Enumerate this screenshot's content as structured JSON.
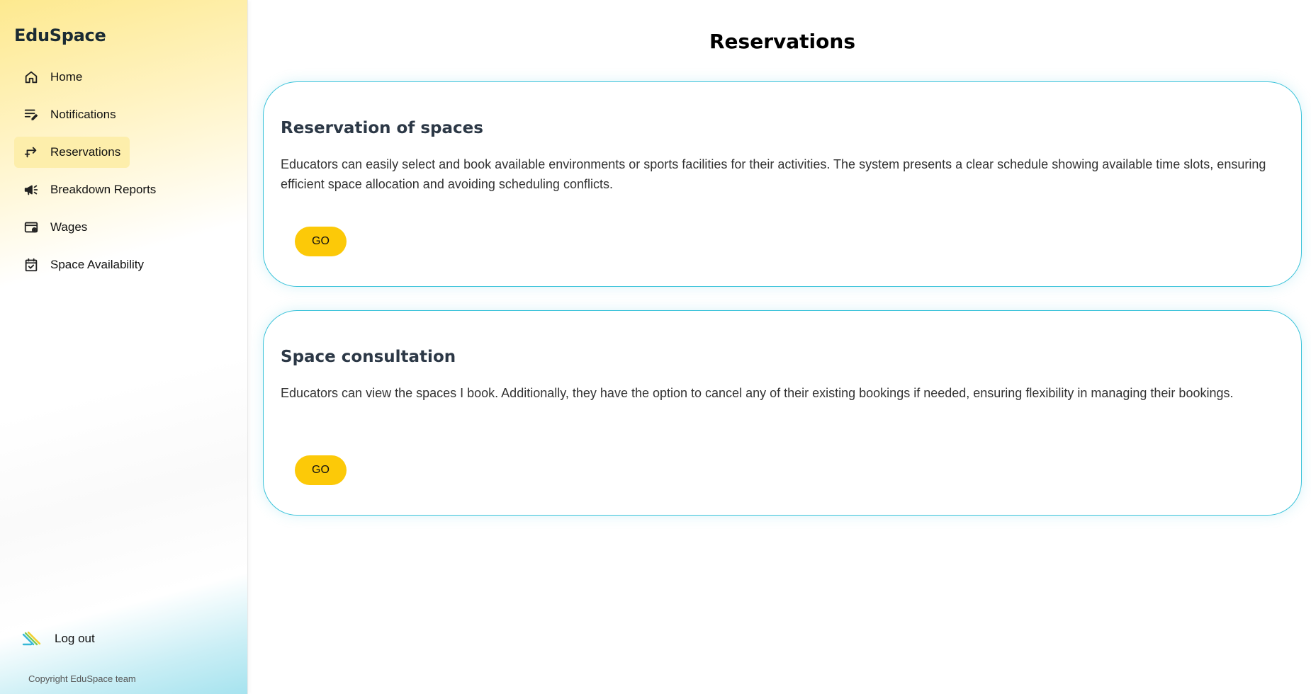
{
  "app": {
    "brand": "EduSpace",
    "page_title": "Reservations"
  },
  "sidebar": {
    "items": [
      {
        "label": "Home",
        "icon": "home-icon",
        "active": false
      },
      {
        "label": "Notifications",
        "icon": "notifications-icon",
        "active": false
      },
      {
        "label": "Reservations",
        "icon": "reservations-icon",
        "active": true
      },
      {
        "label": "Breakdown Reports",
        "icon": "megaphone-icon",
        "active": false
      },
      {
        "label": "Wages",
        "icon": "wages-icon",
        "active": false
      },
      {
        "label": "Space Availability",
        "icon": "calendar-check-icon",
        "active": false
      }
    ],
    "logout_label": "Log out",
    "copyright": "Copyright EduSpace team"
  },
  "cards": [
    {
      "title": "Reservation of spaces",
      "description": "Educators can easily select and book available environments or sports facilities for their activities. The system presents a clear schedule showing available time slots, ensuring efficient space allocation and avoiding scheduling conflicts.",
      "button_label": "GO"
    },
    {
      "title": "Space consultation",
      "description": "Educators can view the spaces I book. Additionally, they have the option to cancel any of their existing bookings if needed, ensuring flexibility in managing their bookings.",
      "button_label": "GO"
    }
  ],
  "colors": {
    "accent_yellow": "#fcc908",
    "active_item_bg": "#fdeeab",
    "card_border": "#3cc3da"
  }
}
